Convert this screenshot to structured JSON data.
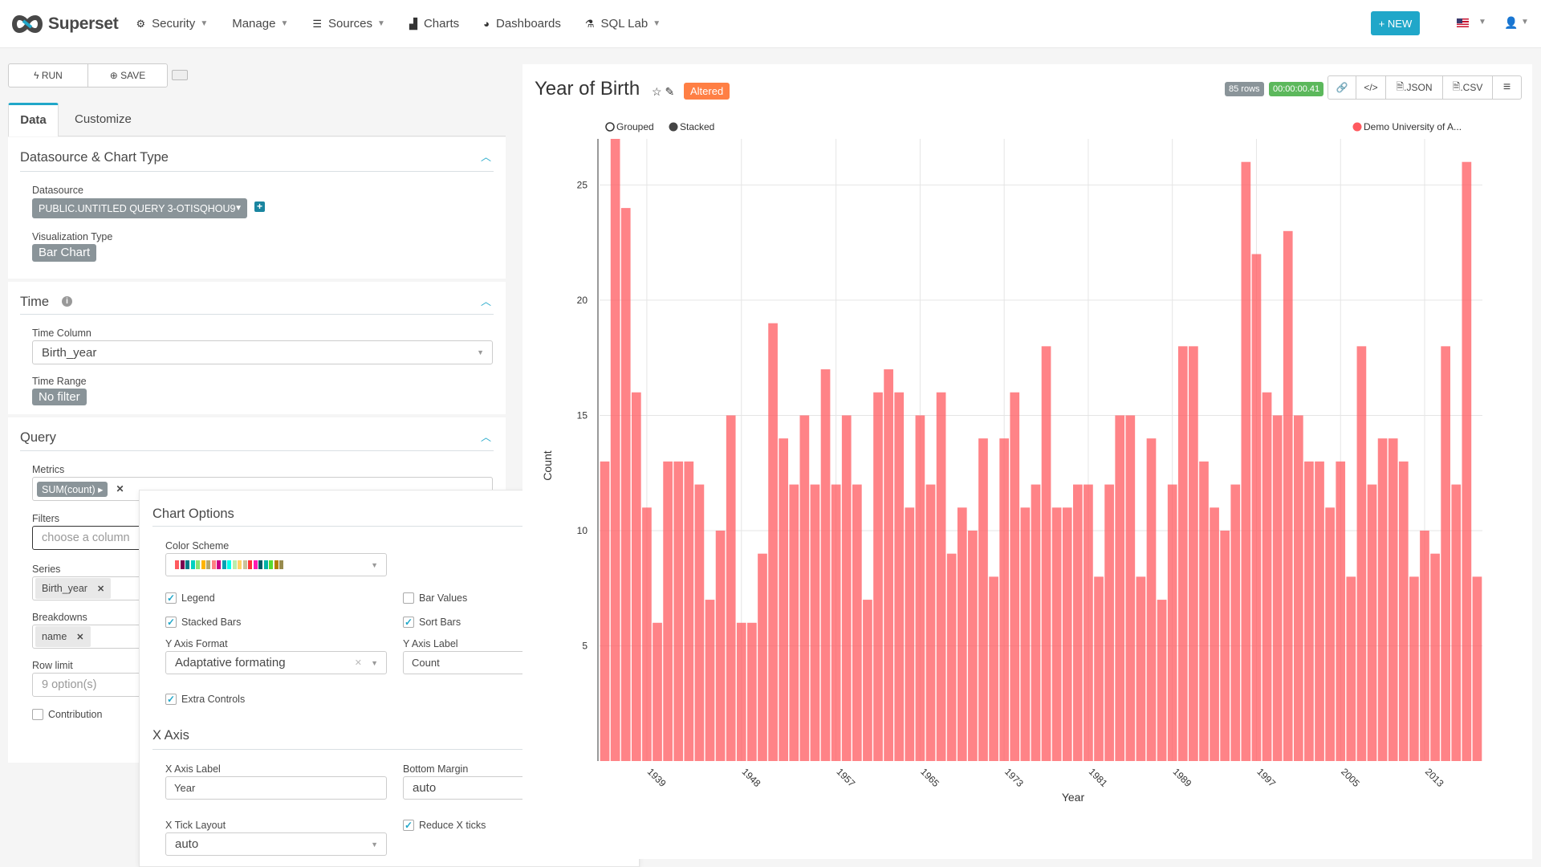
{
  "navbar": {
    "brand": "Superset",
    "items": [
      {
        "label": "Security",
        "icon": "cogs-icon",
        "dropdown": true
      },
      {
        "label": "Manage",
        "icon": "",
        "dropdown": true
      },
      {
        "label": "Sources",
        "icon": "database-icon",
        "dropdown": true
      },
      {
        "label": "Charts",
        "icon": "bar-chart-icon",
        "dropdown": false
      },
      {
        "label": "Dashboards",
        "icon": "dashboard-icon",
        "dropdown": false
      },
      {
        "label": "SQL Lab",
        "icon": "flask-icon",
        "dropdown": true
      }
    ],
    "new_button": "+ NEW",
    "language": "en-US",
    "user_icon": "user-icon"
  },
  "controls": {
    "run_label": "RUN",
    "save_label": "SAVE",
    "tabs": [
      {
        "label": "Data",
        "active": true
      },
      {
        "label": "Customize",
        "active": false
      }
    ]
  },
  "sections": {
    "datasource": {
      "title": "Datasource & Chart Type",
      "datasource_label": "Datasource",
      "datasource_value": "PUBLIC.UNTITLED QUERY 3-OTISQHOU9",
      "viz_label": "Visualization Type",
      "viz_value": "Bar Chart"
    },
    "time": {
      "title": "Time",
      "time_column_label": "Time Column",
      "time_column_value": "Birth_year",
      "time_range_label": "Time Range",
      "time_range_value": "No filter"
    },
    "query": {
      "title": "Query",
      "metrics_label": "Metrics",
      "metrics": [
        "SUM(count)"
      ],
      "filters_label": "Filters",
      "filters_placeholder": "choose a column",
      "series_label": "Series",
      "series": [
        "Birth_year"
      ],
      "breakdowns_label": "Breakdowns",
      "breakdowns": [
        "name"
      ],
      "row_limit_label": "Row limit",
      "row_limit_placeholder": "9 option(s)",
      "contribution_label": "Contribution",
      "contribution_checked": false
    }
  },
  "chart_options": {
    "title": "Chart Options",
    "color_scheme_label": "Color Scheme",
    "color_scheme": [
      "#FF5A5F",
      "#7B0051",
      "#007A87",
      "#00D1C1",
      "#8CE071",
      "#FFB400",
      "#B4A76C",
      "#FF8083",
      "#CC0086",
      "#00A1B3",
      "#00FFEB",
      "#BBEDAB",
      "#FFD266",
      "#CBC29A",
      "#FF3339",
      "#FF1AB1",
      "#005C66",
      "#00B3A6",
      "#55DD30",
      "#B37E00",
      "#988B4E"
    ],
    "legend_label": "Legend",
    "legend_checked": true,
    "bar_values_label": "Bar Values",
    "bar_values_checked": false,
    "stacked_bars_label": "Stacked Bars",
    "stacked_bars_checked": true,
    "sort_bars_label": "Sort Bars",
    "sort_bars_checked": true,
    "y_axis_format_label": "Y Axis Format",
    "y_axis_format_value": "Adaptative formating",
    "y_axis_label_label": "Y Axis Label",
    "y_axis_label_value": "Count",
    "extra_controls_label": "Extra Controls",
    "extra_controls_checked": true
  },
  "x_axis": {
    "title": "X Axis",
    "x_axis_label_label": "X Axis Label",
    "x_axis_label_value": "Year",
    "bottom_margin_label": "Bottom Margin",
    "bottom_margin_value": "auto",
    "x_tick_layout_label": "X Tick Layout",
    "x_tick_layout_value": "auto",
    "reduce_x_ticks_label": "Reduce X ticks",
    "reduce_x_ticks_checked": true
  },
  "chart_header": {
    "title": "Year of Birth",
    "altered_badge": "Altered",
    "rows_badge": "85 rows",
    "time_badge": "00:00:00.41",
    "json_label": ".JSON",
    "csv_label": ".CSV",
    "colors": {
      "altered": "#FF7F44",
      "rows": "#8A9499",
      "time": "#5CB85C"
    }
  },
  "chart_data": {
    "type": "bar",
    "title": "Year of Birth",
    "xlabel": "Year",
    "ylabel": "Count",
    "ylim": [
      0,
      27
    ],
    "yticks": [
      5,
      10,
      15,
      20,
      25
    ],
    "ytick_labels_visible": [
      "15",
      "20",
      "25"
    ],
    "xtick_labels": [
      "1939",
      "1948",
      "1957",
      "1965",
      "1973",
      "1981",
      "1989",
      "1997",
      "2005",
      "2013"
    ],
    "grid": true,
    "controls": [
      {
        "label": "Grouped",
        "selected": false
      },
      {
        "label": "Stacked",
        "selected": true
      }
    ],
    "legend_position": "top-right",
    "series": [
      {
        "name": "Demo University of A...",
        "color": "#FF5A5F",
        "values": [
          13,
          27,
          24,
          16,
          11,
          6,
          13,
          13,
          13,
          12,
          7,
          10,
          15,
          6,
          6,
          9,
          19,
          14,
          12,
          15,
          12,
          17,
          12,
          15,
          12,
          7,
          16,
          17,
          16,
          11,
          15,
          12,
          16,
          9,
          11,
          10,
          14,
          8,
          14,
          16,
          11,
          12,
          18,
          11,
          11,
          12,
          12,
          8,
          12,
          15,
          15,
          8,
          14,
          7,
          12,
          18,
          18,
          13,
          11,
          10,
          12,
          26,
          22,
          16,
          15,
          23,
          15,
          13,
          13,
          11,
          13,
          8,
          18,
          12,
          14,
          14,
          13,
          8,
          10,
          9,
          18,
          12,
          26,
          8
        ]
      }
    ]
  }
}
